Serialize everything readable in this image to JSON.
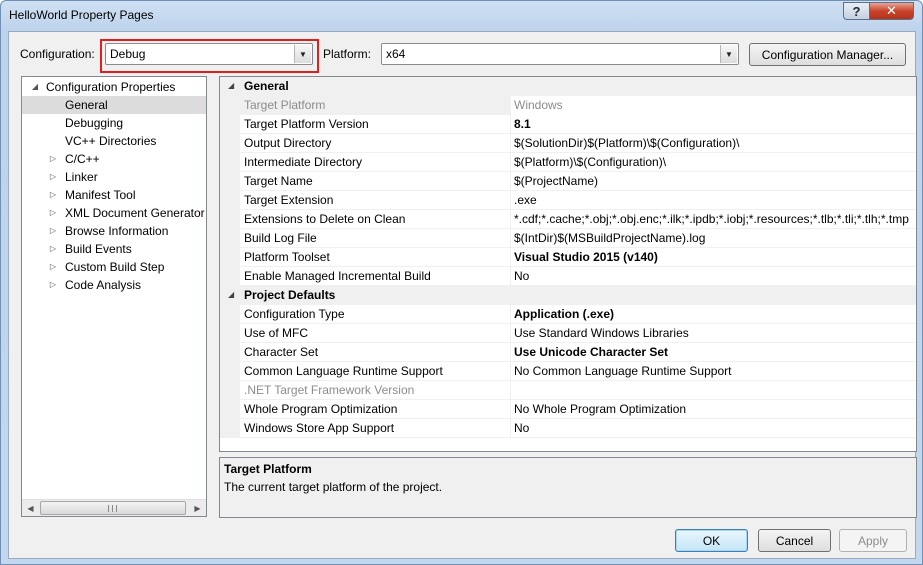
{
  "window": {
    "title": "HelloWorld Property Pages",
    "help_glyph": "?",
    "close_glyph": "✕"
  },
  "toolbar": {
    "configuration_label": "Configuration:",
    "configuration_value": "Debug",
    "platform_label": "Platform:",
    "platform_value": "x64",
    "config_manager_label": "Configuration Manager..."
  },
  "tree": {
    "items": [
      {
        "label": "Configuration Properties",
        "expander": "◢",
        "level": 0
      },
      {
        "label": "General",
        "expander": "",
        "level": 1,
        "selected": true
      },
      {
        "label": "Debugging",
        "expander": "",
        "level": 1
      },
      {
        "label": "VC++ Directories",
        "expander": "",
        "level": 1
      },
      {
        "label": "C/C++",
        "expander": "▷",
        "level": 1
      },
      {
        "label": "Linker",
        "expander": "▷",
        "level": 1
      },
      {
        "label": "Manifest Tool",
        "expander": "▷",
        "level": 1
      },
      {
        "label": "XML Document Generator",
        "expander": "▷",
        "level": 1
      },
      {
        "label": "Browse Information",
        "expander": "▷",
        "level": 1
      },
      {
        "label": "Build Events",
        "expander": "▷",
        "level": 1
      },
      {
        "label": "Custom Build Step",
        "expander": "▷",
        "level": 1
      },
      {
        "label": "Code Analysis",
        "expander": "▷",
        "level": 1
      }
    ],
    "scroll_left_glyph": "◀",
    "scroll_right_glyph": "▶"
  },
  "grid": {
    "category_expander": "◢",
    "rows": [
      {
        "kind": "cat",
        "name": "General"
      },
      {
        "kind": "prop",
        "name": "Target Platform",
        "value": "Windows",
        "dim": true,
        "selected": true
      },
      {
        "kind": "prop",
        "name": "Target Platform Version",
        "value": "8.1",
        "bold": true
      },
      {
        "kind": "prop",
        "name": "Output Directory",
        "value": "$(SolutionDir)$(Platform)\\$(Configuration)\\"
      },
      {
        "kind": "prop",
        "name": "Intermediate Directory",
        "value": "$(Platform)\\$(Configuration)\\"
      },
      {
        "kind": "prop",
        "name": "Target Name",
        "value": "$(ProjectName)"
      },
      {
        "kind": "prop",
        "name": "Target Extension",
        "value": ".exe"
      },
      {
        "kind": "prop",
        "name": "Extensions to Delete on Clean",
        "value": "*.cdf;*.cache;*.obj;*.obj.enc;*.ilk;*.ipdb;*.iobj;*.resources;*.tlb;*.tli;*.tlh;*.tmp"
      },
      {
        "kind": "prop",
        "name": "Build Log File",
        "value": "$(IntDir)$(MSBuildProjectName).log"
      },
      {
        "kind": "prop",
        "name": "Platform Toolset",
        "value": "Visual Studio 2015 (v140)",
        "bold": true
      },
      {
        "kind": "prop",
        "name": "Enable Managed Incremental Build",
        "value": "No"
      },
      {
        "kind": "cat",
        "name": "Project Defaults"
      },
      {
        "kind": "prop",
        "name": "Configuration Type",
        "value": "Application (.exe)",
        "bold": true
      },
      {
        "kind": "prop",
        "name": "Use of MFC",
        "value": "Use Standard Windows Libraries"
      },
      {
        "kind": "prop",
        "name": "Character Set",
        "value": "Use Unicode Character Set",
        "bold": true
      },
      {
        "kind": "prop",
        "name": "Common Language Runtime Support",
        "value": "No Common Language Runtime Support"
      },
      {
        "kind": "prop",
        "name": ".NET Target Framework Version",
        "value": "",
        "dim": true
      },
      {
        "kind": "prop",
        "name": "Whole Program Optimization",
        "value": "No Whole Program Optimization"
      },
      {
        "kind": "prop",
        "name": "Windows Store App Support",
        "value": "No"
      }
    ]
  },
  "description": {
    "title": "Target Platform",
    "text": "The current target platform of the project."
  },
  "buttons": {
    "ok": "OK",
    "cancel": "Cancel",
    "apply": "Apply"
  },
  "icons": {
    "dropdown_arrow": "▼"
  },
  "colors": {
    "highlight_box": "#e0201e"
  }
}
